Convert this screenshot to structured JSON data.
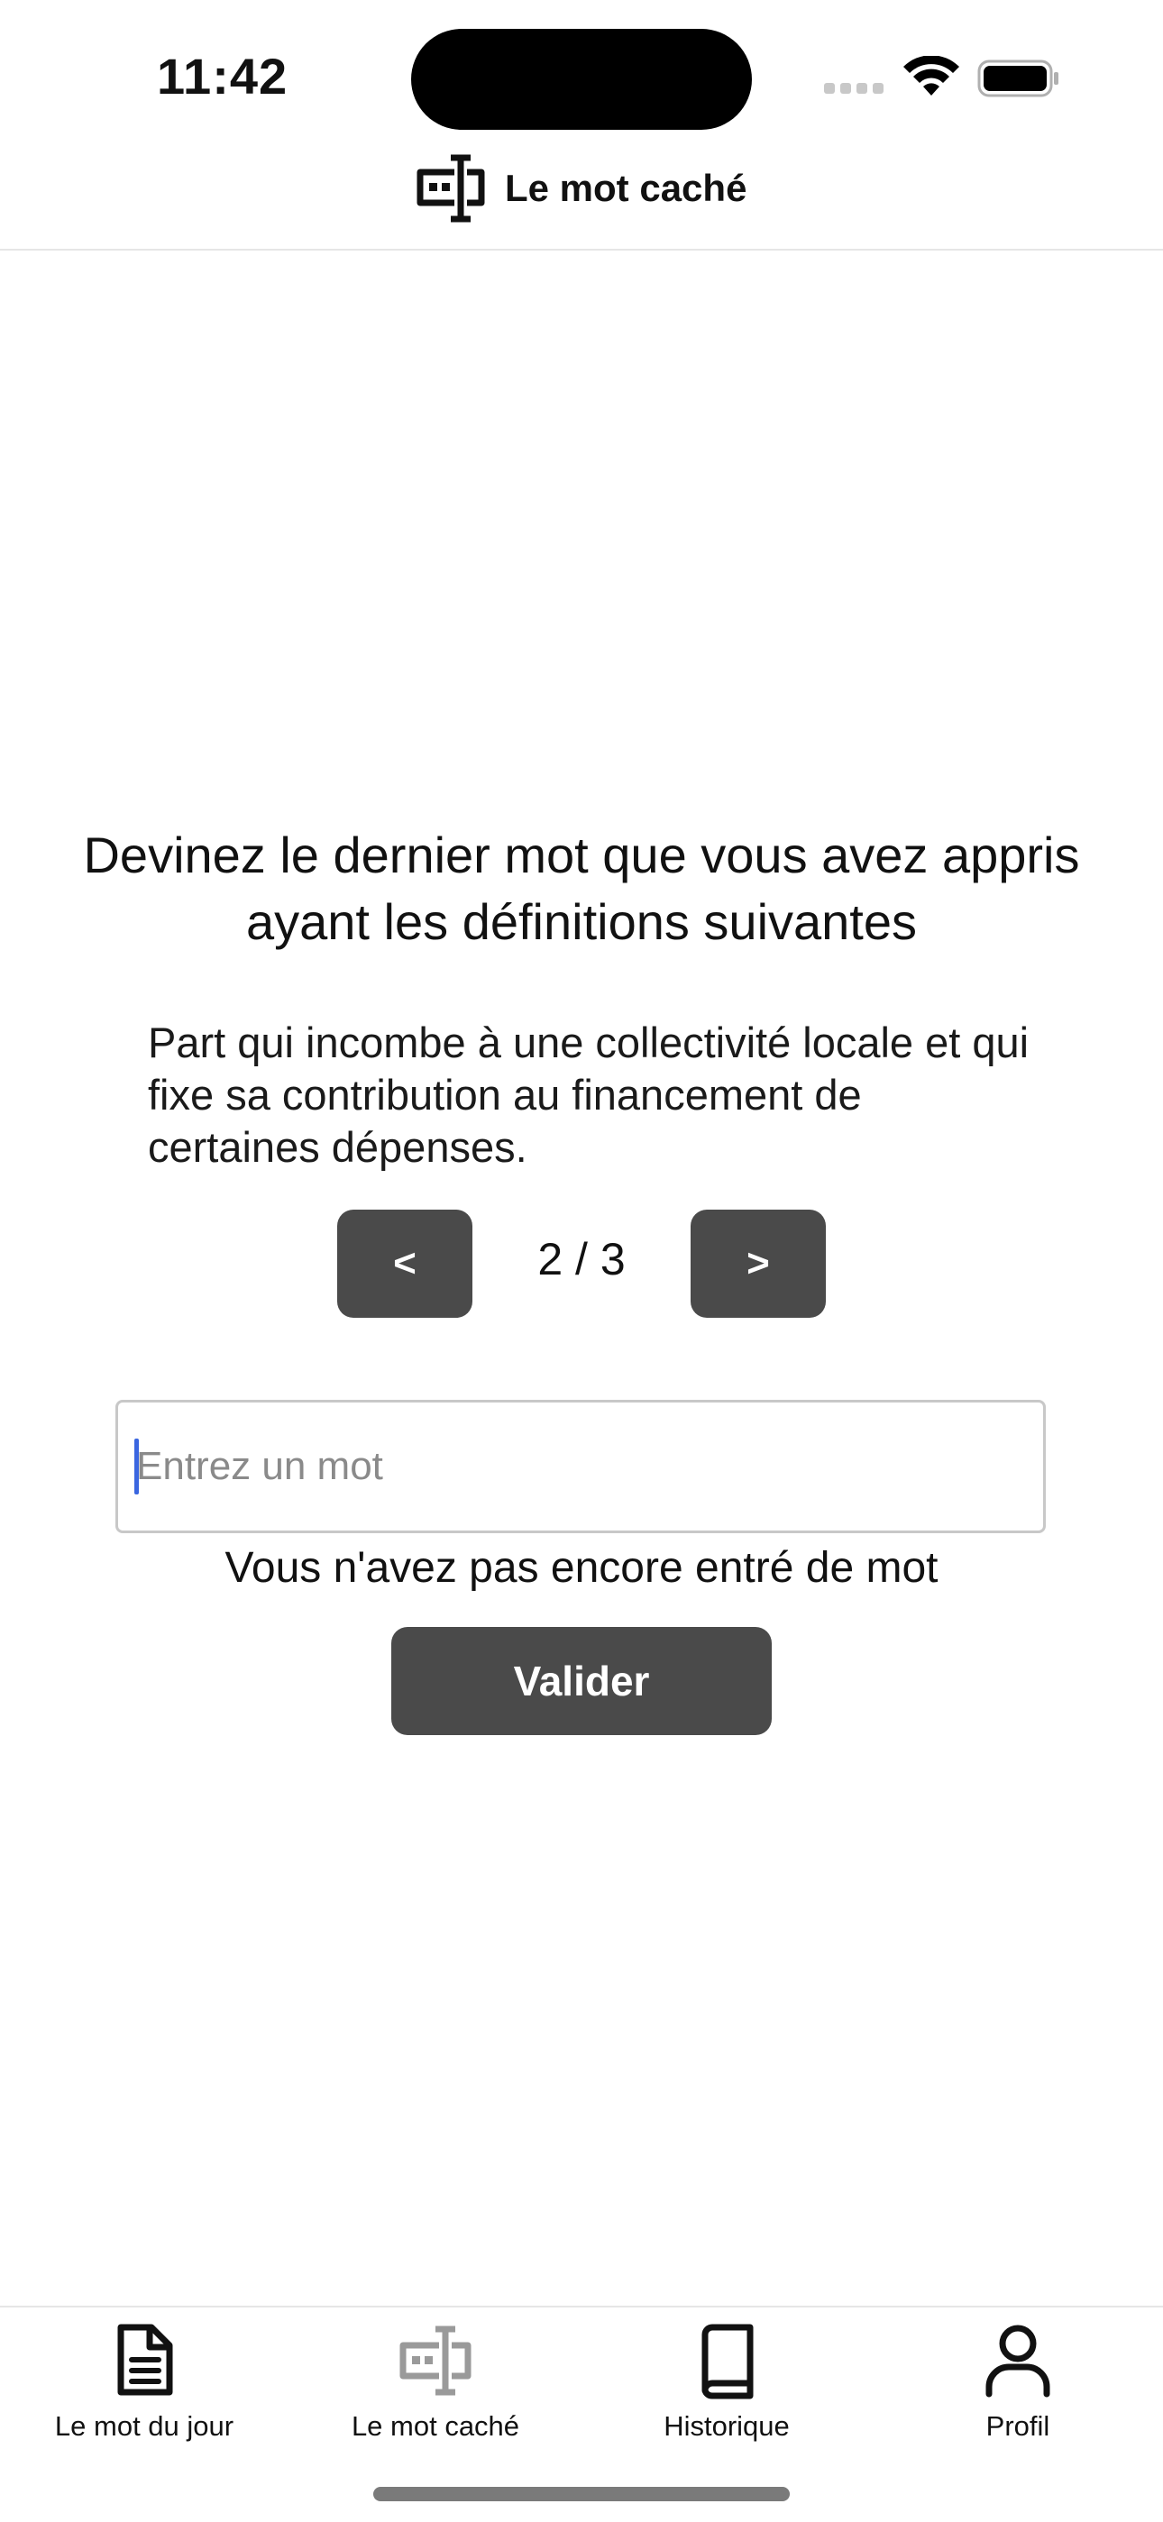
{
  "status_bar": {
    "time": "11:42"
  },
  "header": {
    "title": "Le mot caché",
    "logo_icon": "text-cursor-box-icon"
  },
  "main": {
    "question": "Devinez le dernier mot que vous avez appris ayant les définitions suivantes",
    "definition": "Part qui incombe à une collectivité locale et qui fixe sa contribution au financement de certaines dépenses.",
    "pager": {
      "prev_label": "<",
      "next_label": ">",
      "indicator": "2 / 3"
    },
    "input": {
      "placeholder": "Entrez un mot",
      "value": ""
    },
    "status_message": "Vous n'avez pas encore entré de mot",
    "validate_label": "Valider"
  },
  "tabs": [
    {
      "label": "Le mot du jour",
      "icon": "document-icon",
      "active": false
    },
    {
      "label": "Le mot caché",
      "icon": "text-cursor-box-icon",
      "active": true
    },
    {
      "label": "Historique",
      "icon": "book-icon",
      "active": false
    },
    {
      "label": "Profil",
      "icon": "user-icon",
      "active": false
    }
  ],
  "colors": {
    "button_bg": "#4a4a4a",
    "caret": "#3a66e0",
    "active_tab_icon": "#9a9a9a",
    "text": "#111111"
  }
}
